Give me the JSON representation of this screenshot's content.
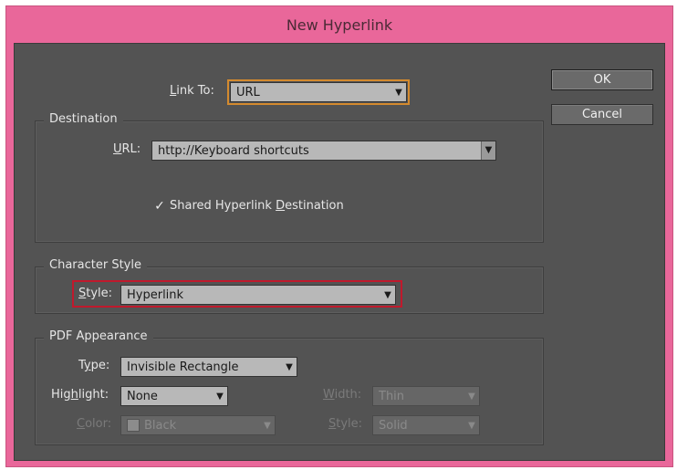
{
  "window": {
    "title": "New Hyperlink"
  },
  "link_to": {
    "label": "Link To:",
    "value": "URL"
  },
  "destination": {
    "legend": "Destination",
    "url_label": "URL:",
    "url_value": "http://Keyboard shortcuts",
    "shared_label": "Shared Hyperlink Destination",
    "shared_checked": true
  },
  "character_style": {
    "legend": "Character Style",
    "style_label": "Style:",
    "style_value": "Hyperlink"
  },
  "pdf_appearance": {
    "legend": "PDF Appearance",
    "type_label": "Type:",
    "type_value": "Invisible Rectangle",
    "highlight_label": "Highlight:",
    "highlight_value": "None",
    "color_label": "Color:",
    "color_value": "Black",
    "width_label": "Width:",
    "width_value": "Thin",
    "style_label": "Style:",
    "style_value": "Solid"
  },
  "buttons": {
    "ok": "OK",
    "cancel": "Cancel"
  },
  "icons": {
    "dropdown_arrow": "▼",
    "checkmark": "✓"
  },
  "colors": {
    "frame": "#e9679a",
    "panel": "#535353",
    "focus_outline": "#d48a2e",
    "annotation_box": "#c0192c"
  }
}
